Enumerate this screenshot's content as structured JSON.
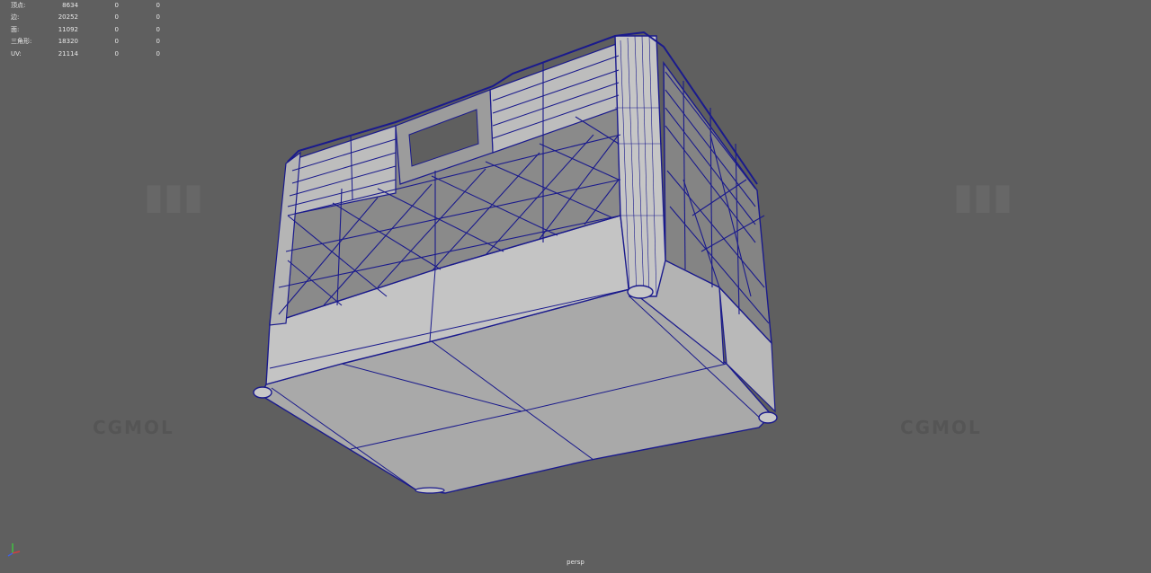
{
  "hud": {
    "rows": [
      {
        "label": "顶点:",
        "v1": "8634",
        "v2": "0",
        "v3": "0"
      },
      {
        "label": "边:",
        "v1": "20252",
        "v2": "0",
        "v3": "0"
      },
      {
        "label": "面:",
        "v1": "11092",
        "v2": "0",
        "v3": "0"
      },
      {
        "label": "三角形:",
        "v1": "18320",
        "v2": "0",
        "v3": "0"
      },
      {
        "label": "UV:",
        "v1": "21114",
        "v2": "0",
        "v3": "0"
      }
    ]
  },
  "camera": {
    "label": "persp"
  },
  "watermark": {
    "text": "CGMOL"
  },
  "colors": {
    "background": "#5f5f5f",
    "wire": "#1a1a8c",
    "surface": "#bfbfbf",
    "surface_dark": "#a9a9a9"
  },
  "axis_icon": "xyz-axis-icon"
}
